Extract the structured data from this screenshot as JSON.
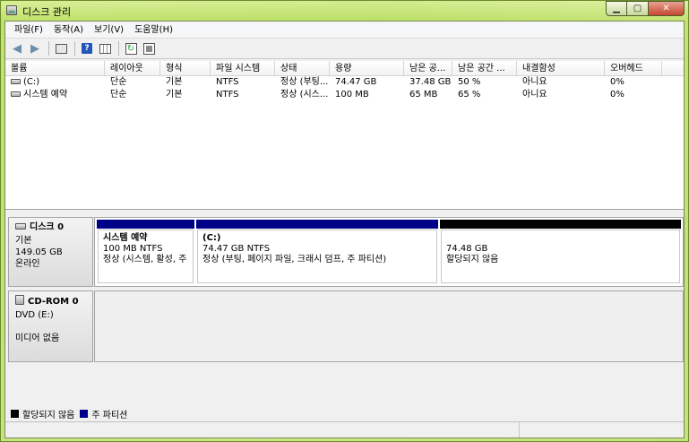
{
  "window": {
    "title": "디스크 관리"
  },
  "menu": [
    "파일(F)",
    "동작(A)",
    "보기(V)",
    "도움말(H)"
  ],
  "columns": [
    "볼륨",
    "레이아웃",
    "형식",
    "파일 시스템",
    "상태",
    "용량",
    "남은 공...",
    "남은 공간 ...",
    "내결함성",
    "오버헤드"
  ],
  "volumes": [
    {
      "name": "(C:)",
      "layout": "단순",
      "type": "기본",
      "fs": "NTFS",
      "status": "정상 (부팅...",
      "capacity": "74.47 GB",
      "free": "37.48 GB",
      "free_pct": "50 %",
      "fault": "아니요",
      "overhead": "0%"
    },
    {
      "name": "시스템 예약",
      "layout": "단순",
      "type": "기본",
      "fs": "NTFS",
      "status": "정상 (시스...",
      "capacity": "100 MB",
      "free": "65 MB",
      "free_pct": "65 %",
      "fault": "아니요",
      "overhead": "0%"
    }
  ],
  "disks": [
    {
      "name": "디스크 0",
      "kind": "기본",
      "size": "149.05 GB",
      "state": "온라인",
      "partitions": [
        {
          "name": "시스템 예약",
          "line1": "100 MB NTFS",
          "line2": "정상 (시스템, 활성, 주"
        },
        {
          "name": "(C:)",
          "line1": "74.47 GB NTFS",
          "line2": "정상 (부팅, 페이지 파일, 크래시 덤프, 주 파티션)"
        },
        {
          "name": "",
          "line1": "74.48 GB",
          "line2": "할당되지 않음"
        }
      ]
    },
    {
      "name": "CD-ROM 0",
      "kind": "DVD (E:)",
      "size": "",
      "state": "미디어 없음"
    }
  ],
  "legend": [
    {
      "label": "할당되지 않음",
      "color": "#000000"
    },
    {
      "label": "주 파티션",
      "color": "#000088"
    }
  ]
}
